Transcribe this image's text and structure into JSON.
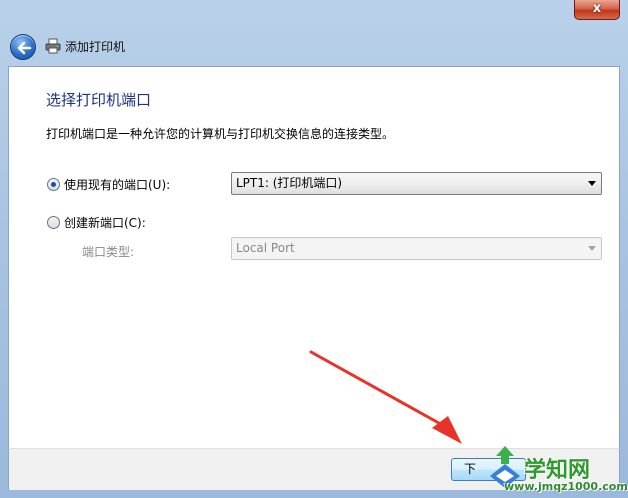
{
  "window": {
    "title": "添加打印机",
    "close_glyph": "x"
  },
  "page": {
    "heading": "选择打印机端口",
    "description": "打印机端口是一种允许您的计算机与打印机交换信息的连接类型。"
  },
  "options": {
    "use_existing": {
      "label": "使用现有的端口(U):",
      "checked": true
    },
    "existing_port_value": "LPT1: (打印机端口)",
    "create_new": {
      "label": "创建新端口(C):",
      "checked": false
    },
    "port_type_label": "端口类型:",
    "port_type_value": "Local Port"
  },
  "footer": {
    "next_label": "下"
  },
  "watermark": {
    "text": "学知网",
    "url": "www.jmqz1000.com"
  },
  "icons": {
    "back": "back-arrow-icon",
    "printer": "printer-icon",
    "dropdown": "chevron-down-icon"
  },
  "colors": {
    "heading": "#1e3287",
    "annotation_arrow": "#e8322a",
    "watermark": "#2f9b2f"
  }
}
